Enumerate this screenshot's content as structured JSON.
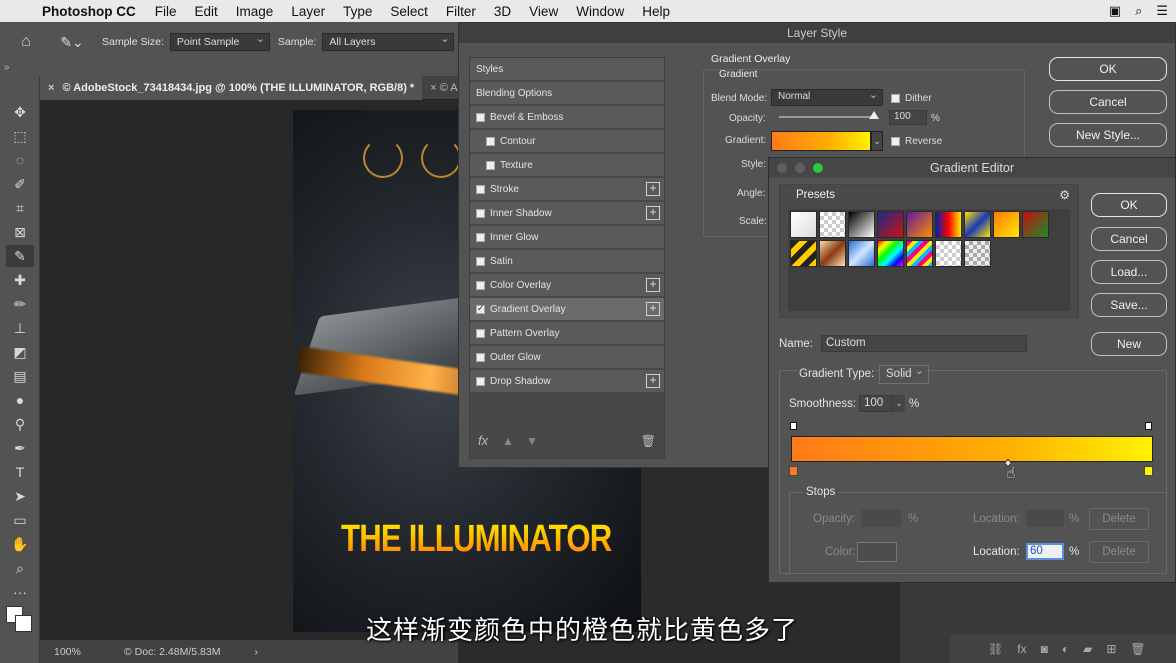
{
  "menubar": {
    "app_name": "Photoshop CC",
    "items": [
      "File",
      "Edit",
      "Image",
      "Layer",
      "Type",
      "Select",
      "Filter",
      "3D",
      "View",
      "Window",
      "Help"
    ]
  },
  "options_bar": {
    "sample_size_label": "Sample Size:",
    "sample_size_value": "Point Sample",
    "sample_label": "Sample:",
    "sample_value": "All Layers"
  },
  "document": {
    "tab_title": "© AdobeStock_73418434.jpg @ 100% (THE ILLUMINATOR, RGB/8) *",
    "tab_title_2": "© A",
    "poster_title": "THE ILLUMINATOR",
    "zoom": "100%",
    "doc_size": "© Doc: 2.48M/5.83M"
  },
  "layer_style": {
    "title": "Layer Style",
    "styles_header": "Styles",
    "items": [
      {
        "label": "Blending Options",
        "checkbox": false,
        "plus": false,
        "sub": false,
        "checked": false
      },
      {
        "label": "Bevel & Emboss",
        "checkbox": true,
        "plus": false,
        "sub": false,
        "checked": false
      },
      {
        "label": "Contour",
        "checkbox": true,
        "plus": false,
        "sub": true,
        "checked": false
      },
      {
        "label": "Texture",
        "checkbox": true,
        "plus": false,
        "sub": true,
        "checked": false
      },
      {
        "label": "Stroke",
        "checkbox": true,
        "plus": true,
        "sub": false,
        "checked": false
      },
      {
        "label": "Inner Shadow",
        "checkbox": true,
        "plus": true,
        "sub": false,
        "checked": false
      },
      {
        "label": "Inner Glow",
        "checkbox": true,
        "plus": false,
        "sub": false,
        "checked": false
      },
      {
        "label": "Satin",
        "checkbox": true,
        "plus": false,
        "sub": false,
        "checked": false
      },
      {
        "label": "Color Overlay",
        "checkbox": true,
        "plus": true,
        "sub": false,
        "checked": false
      },
      {
        "label": "Gradient Overlay",
        "checkbox": true,
        "plus": true,
        "sub": false,
        "checked": true
      },
      {
        "label": "Pattern Overlay",
        "checkbox": true,
        "plus": false,
        "sub": false,
        "checked": false
      },
      {
        "label": "Outer Glow",
        "checkbox": true,
        "plus": false,
        "sub": false,
        "checked": false
      },
      {
        "label": "Drop Shadow",
        "checkbox": true,
        "plus": true,
        "sub": false,
        "checked": false
      }
    ],
    "gradient_overlay": {
      "section_title": "Gradient Overlay",
      "group_title": "Gradient",
      "blend_mode_label": "Blend Mode:",
      "blend_mode_value": "Normal",
      "dither_label": "Dither",
      "opacity_label": "Opacity:",
      "opacity_value": "100",
      "percent": "%",
      "gradient_label": "Gradient:",
      "reverse_label": "Reverse",
      "style_label": "Style:",
      "angle_label": "Angle:",
      "scale_label": "Scale:"
    },
    "buttons": {
      "ok": "OK",
      "cancel": "Cancel",
      "new_style": "New Style..."
    },
    "fx": "fx"
  },
  "gradient_editor": {
    "title": "Gradient Editor",
    "presets_label": "Presets",
    "name_label": "Name:",
    "name_value": "Custom",
    "gradient_type_label": "Gradient Type:",
    "gradient_type_value": "Solid",
    "smoothness_label": "Smoothness:",
    "smoothness_value": "100",
    "percent": "%",
    "stops_label": "Stops",
    "opacity_label": "Opacity:",
    "location_label": "Location:",
    "color_label": "Color:",
    "location_value": "60",
    "delete_label": "Delete",
    "buttons": {
      "ok": "OK",
      "cancel": "Cancel",
      "load": "Load...",
      "save": "Save...",
      "new": "New"
    },
    "gradient_start_color": "#ff7a1a",
    "gradient_end_color": "#fff200",
    "midpoint_location": 60
  },
  "subtitle": "这样渐变颜色中的橙色就比黄色多了",
  "colors": {
    "accent_orange": "#ff7a1a",
    "accent_yellow": "#fff200",
    "dialog_bg": "#535353"
  }
}
